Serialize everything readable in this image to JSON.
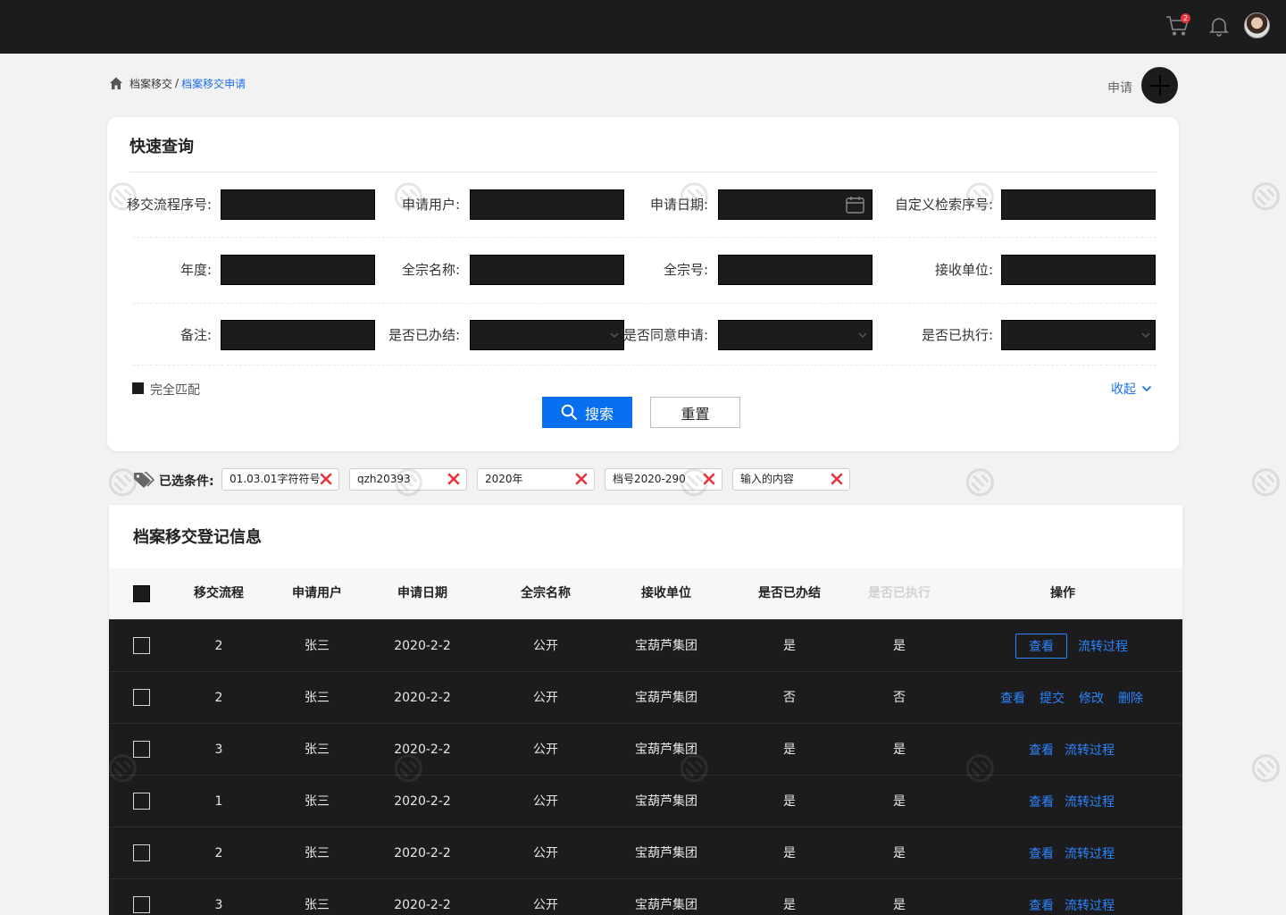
{
  "header": {
    "cart_badge": "2",
    "icons": [
      "cart-icon",
      "bell-icon",
      "avatar"
    ]
  },
  "breadcrumb": {
    "root": "档案移交",
    "separator": "/",
    "current": "档案移交申请"
  },
  "apply": {
    "label": "申请"
  },
  "query": {
    "title": "快速查询",
    "fields": [
      {
        "label": "移交流程序号:",
        "type": "text",
        "value": ""
      },
      {
        "label": "申请用户:",
        "type": "text",
        "value": ""
      },
      {
        "label": "申请日期:",
        "type": "date",
        "value": ""
      },
      {
        "label": "自定义检索序号:",
        "type": "text",
        "value": ""
      },
      {
        "label": "年度:",
        "type": "text",
        "value": ""
      },
      {
        "label": "全宗名称:",
        "type": "text",
        "value": ""
      },
      {
        "label": "全宗号:",
        "type": "text",
        "value": ""
      },
      {
        "label": "接收单位:",
        "type": "text",
        "value": ""
      },
      {
        "label": "备注:",
        "type": "text",
        "value": ""
      },
      {
        "label": "是否已办结:",
        "type": "select",
        "value": ""
      },
      {
        "label": "是否同意申请:",
        "type": "select",
        "value": ""
      },
      {
        "label": "是否已执行:",
        "type": "select",
        "value": ""
      }
    ],
    "exact_match_label": "完全匹配",
    "collapse_label": "收起",
    "search_label": "搜索",
    "reset_label": "重置"
  },
  "filters": {
    "label": "已选条件:",
    "tags": [
      "01.03.01字符符号",
      "qzh20393",
      "2020年",
      "档号2020-290",
      "输入的内容"
    ]
  },
  "list": {
    "title": "档案移交登记信息",
    "columns": [
      "移交流程",
      "申请用户",
      "申请日期",
      "全宗名称",
      "接收单位",
      "是否已办结",
      "是否已执行",
      "操作"
    ],
    "rows": [
      {
        "flow": "2",
        "user": "张三",
        "date": "2020-2-2",
        "fonds": "公开",
        "unit": "宝葫芦集团",
        "done": "是",
        "executed": "是",
        "actions": [
          "查看",
          "流转过程"
        ]
      },
      {
        "flow": "2",
        "user": "张三",
        "date": "2020-2-2",
        "fonds": "公开",
        "unit": "宝葫芦集团",
        "done": "否",
        "executed": "否",
        "actions": [
          "查看",
          "提交",
          "修改",
          "删除"
        ]
      },
      {
        "flow": "3",
        "user": "张三",
        "date": "2020-2-2",
        "fonds": "公开",
        "unit": "宝葫芦集团",
        "done": "是",
        "executed": "是",
        "actions": [
          "查看",
          "流转过程"
        ]
      },
      {
        "flow": "1",
        "user": "张三",
        "date": "2020-2-2",
        "fonds": "公开",
        "unit": "宝葫芦集团",
        "done": "是",
        "executed": "是",
        "actions": [
          "查看",
          "流转过程"
        ]
      },
      {
        "flow": "2",
        "user": "张三",
        "date": "2020-2-2",
        "fonds": "公开",
        "unit": "宝葫芦集团",
        "done": "是",
        "executed": "是",
        "actions": [
          "查看",
          "流转过程"
        ]
      },
      {
        "flow": "3",
        "user": "张三",
        "date": "2020-2-2",
        "fonds": "公开",
        "unit": "宝葫芦集团",
        "done": "是",
        "executed": "是",
        "actions": [
          "查看",
          "流转过程"
        ]
      }
    ]
  },
  "watermark": "Wondershare MoDao",
  "colors": {
    "accent": "#0a6ef0",
    "link": "#2a86ff",
    "dark": "#1c1c1e",
    "danger": "#e8343a"
  }
}
